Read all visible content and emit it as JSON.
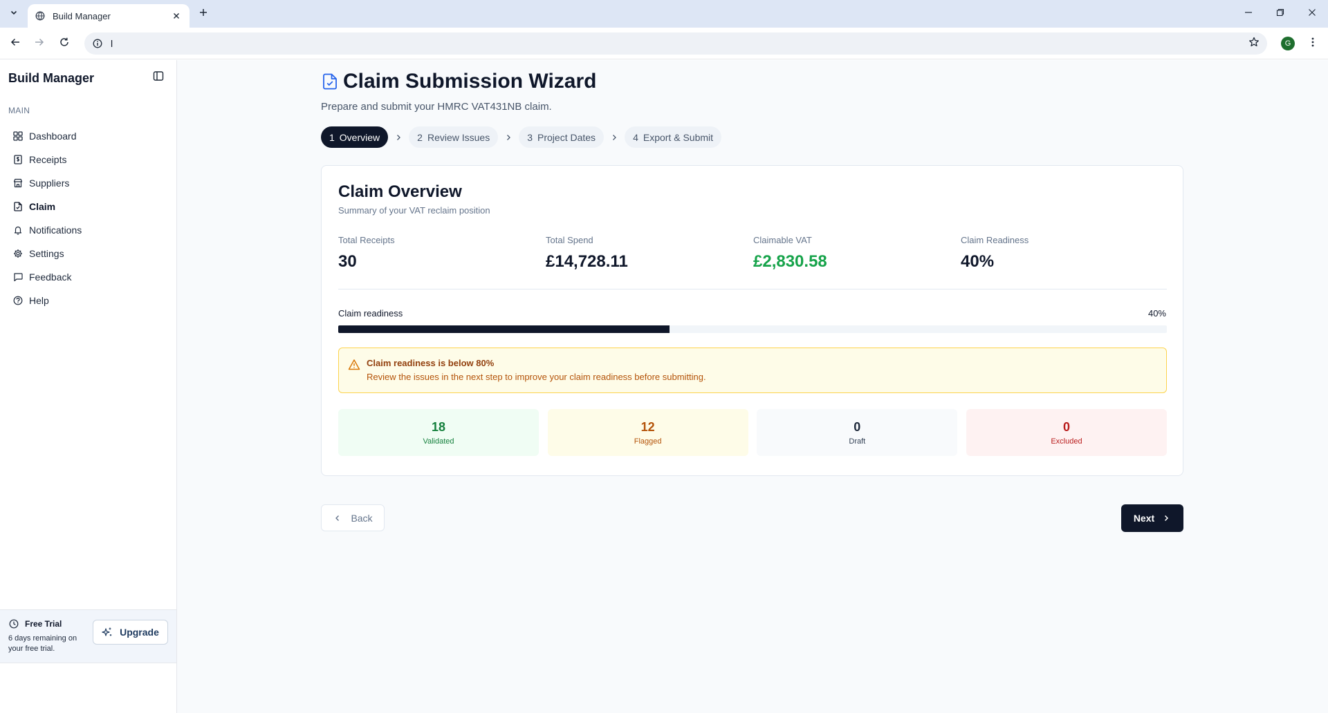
{
  "browser": {
    "tab_title": "Build Manager",
    "address": "l",
    "profile_initial": "G"
  },
  "sidebar": {
    "brand": "Build Manager",
    "section_label": "MAIN",
    "items": [
      {
        "label": "Dashboard",
        "icon": "grid-icon"
      },
      {
        "label": "Receipts",
        "icon": "receipt-icon"
      },
      {
        "label": "Suppliers",
        "icon": "store-icon"
      },
      {
        "label": "Claim",
        "icon": "file-check-icon",
        "active": true
      },
      {
        "label": "Notifications",
        "icon": "bell-icon"
      },
      {
        "label": "Settings",
        "icon": "gear-icon"
      },
      {
        "label": "Feedback",
        "icon": "message-square-icon"
      },
      {
        "label": "Help",
        "icon": "help-circle-icon"
      }
    ],
    "trial": {
      "title": "Free Trial",
      "description": "6 days remaining on your free trial.",
      "upgrade_label": "Upgrade"
    }
  },
  "header": {
    "title": "Claim Submission Wizard",
    "subtitle": "Prepare and submit your HMRC VAT431NB claim."
  },
  "steps": [
    {
      "num": "1",
      "label": "Overview",
      "active": true
    },
    {
      "num": "2",
      "label": "Review Issues"
    },
    {
      "num": "3",
      "label": "Project Dates"
    },
    {
      "num": "4",
      "label": "Export & Submit"
    }
  ],
  "overview": {
    "title": "Claim Overview",
    "subtitle": "Summary of your VAT reclaim position",
    "stats": [
      {
        "label": "Total Receipts",
        "value": "30"
      },
      {
        "label": "Total Spend",
        "value": "£14,728.11"
      },
      {
        "label": "Claimable VAT",
        "value": "£2,830.58"
      },
      {
        "label": "Claim Readiness",
        "value": "40%"
      }
    ],
    "progress": {
      "label": "Claim readiness",
      "value_text": "40%",
      "value": 0.4
    },
    "alert": {
      "title": "Claim readiness is below 80%",
      "text": "Review the issues in the next step to improve your claim readiness before submitting."
    },
    "tiles": [
      {
        "count": "18",
        "label": "Validated"
      },
      {
        "count": "12",
        "label": "Flagged"
      },
      {
        "count": "0",
        "label": "Draft"
      },
      {
        "count": "0",
        "label": "Excluded"
      }
    ]
  },
  "footer": {
    "back_label": "Back",
    "next_label": "Next"
  },
  "colors": {
    "primary": "#0f172a",
    "success": "#16a34a",
    "warning": "#b45309",
    "danger": "#b91c1c"
  }
}
